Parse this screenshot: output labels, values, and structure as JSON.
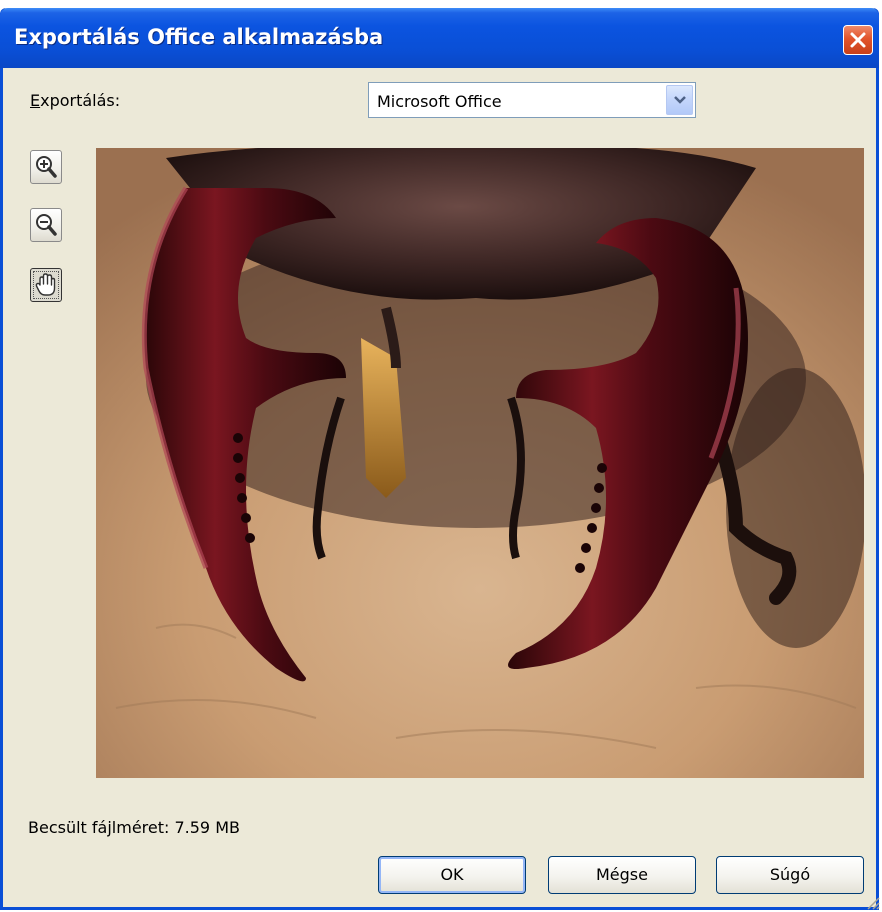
{
  "window": {
    "title": "Exportálás Office alkalmazásba"
  },
  "export": {
    "label_accel": "E",
    "label_rest": "xportálás:",
    "selected": "Microsoft Office"
  },
  "tools": {
    "zoom_in": "zoom-in-icon",
    "zoom_out": "zoom-out-icon",
    "pan": "hand-icon"
  },
  "preview": {
    "subject": "stag beetle mandibles photo"
  },
  "status": {
    "estimated_size": "Becsült fájlméret: 7.59 MB"
  },
  "buttons": {
    "ok": "OK",
    "cancel": "Mégse",
    "help": "Súgó"
  },
  "colors": {
    "titlebar": "#0a4fd6",
    "dialog_bg": "#ece9d8",
    "close": "#e2542c"
  }
}
